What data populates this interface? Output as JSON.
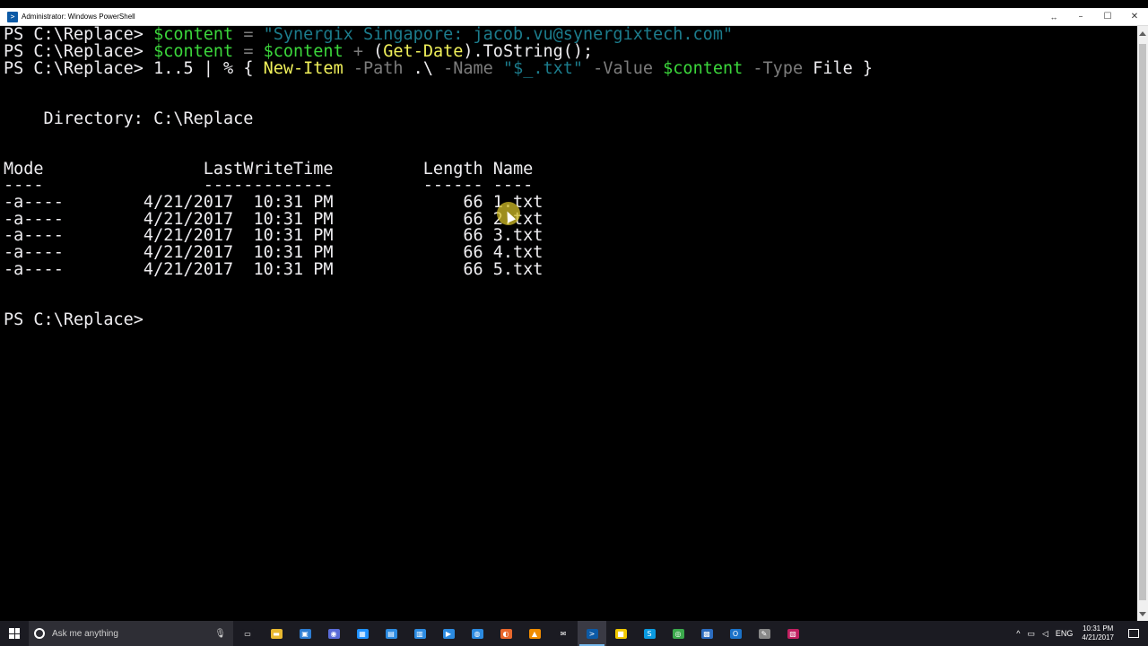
{
  "window": {
    "title": "Administrator: Windows PowerShell",
    "controls": {
      "minimize": "–",
      "maximize": "☐",
      "close": "✕",
      "resize": "↔"
    }
  },
  "console": {
    "line1": {
      "prompt": "PS C:\\Replace> ",
      "var": "$content",
      "op": " = ",
      "str": "\"Synergix Singapore: jacob.vu@synergixtech.com\""
    },
    "line2": {
      "prompt": "PS C:\\Replace> ",
      "var": "$content",
      "op": " = ",
      "var2": "$content",
      "op2": " + ",
      "p1": "(",
      "cmd": "Get-Date",
      "p2": ").ToString();"
    },
    "line3": {
      "prompt": "PS C:\\Replace> ",
      "range": "1..5",
      "pipe": " | % { ",
      "cmd": "New-Item",
      "param1": " -Path",
      "arg1": " .\\",
      "param2": " -Name",
      "str": " \"$_.txt\"",
      "param3": " -Value",
      "var": " $content",
      "param4": " -Type",
      "arg2": " File }"
    },
    "directory": "    Directory: C:\\Replace",
    "header": "Mode                LastWriteTime         Length Name",
    "separator": "----                -------------         ------ ----",
    "rows": [
      "-a----        4/21/2017  10:31 PM             66 1.txt",
      "-a----        4/21/2017  10:31 PM             66 2.txt",
      "-a----        4/21/2017  10:31 PM             66 3.txt",
      "-a----        4/21/2017  10:31 PM             66 4.txt",
      "-a----        4/21/2017  10:31 PM             66 5.txt"
    ],
    "final_prompt": "PS C:\\Replace>"
  },
  "taskbar": {
    "search_placeholder": "Ask me anything",
    "apps": [
      {
        "name": "task-view-icon",
        "glyph": "▭",
        "color": "#1b1b22"
      },
      {
        "name": "file-explorer-icon",
        "glyph": "▬",
        "color": "#e8b830"
      },
      {
        "name": "store-icon",
        "glyph": "▣",
        "color": "#2d7dd2"
      },
      {
        "name": "mail-app-icon",
        "glyph": "◉",
        "color": "#5a6cd8"
      },
      {
        "name": "calculator-icon",
        "glyph": "▦",
        "color": "#1e90ff"
      },
      {
        "name": "photos-icon",
        "glyph": "▤",
        "color": "#2b8ae0"
      },
      {
        "name": "people-icon",
        "glyph": "▥",
        "color": "#2b8ae0"
      },
      {
        "name": "media-icon",
        "glyph": "▶",
        "color": "#2b8ae0"
      },
      {
        "name": "globe-icon",
        "glyph": "◍",
        "color": "#2b8ae0"
      },
      {
        "name": "firefox-icon",
        "glyph": "◐",
        "color": "#e8672c"
      },
      {
        "name": "vlc-icon",
        "glyph": "▲",
        "color": "#f08c00"
      },
      {
        "name": "mail-icon",
        "glyph": "✉",
        "color": "#1b1b22"
      },
      {
        "name": "powershell-icon",
        "glyph": ">",
        "color": "#0c5aa6"
      },
      {
        "name": "notes-icon",
        "glyph": "■",
        "color": "#f0c800"
      },
      {
        "name": "skype-icon",
        "glyph": "S",
        "color": "#0a9ae0"
      },
      {
        "name": "chrome-icon",
        "glyph": "◎",
        "color": "#3ba94c"
      },
      {
        "name": "remote-desktop-icon",
        "glyph": "▩",
        "color": "#2b6cc0"
      },
      {
        "name": "outlook-icon",
        "glyph": "O",
        "color": "#1b72c8"
      },
      {
        "name": "tools-icon",
        "glyph": "✎",
        "color": "#888888"
      },
      {
        "name": "app-icon",
        "glyph": "▧",
        "color": "#c02060"
      }
    ],
    "tray": {
      "chevron": "^",
      "language": "ENG",
      "time": "10:31 PM",
      "date": "4/21/2017"
    }
  }
}
